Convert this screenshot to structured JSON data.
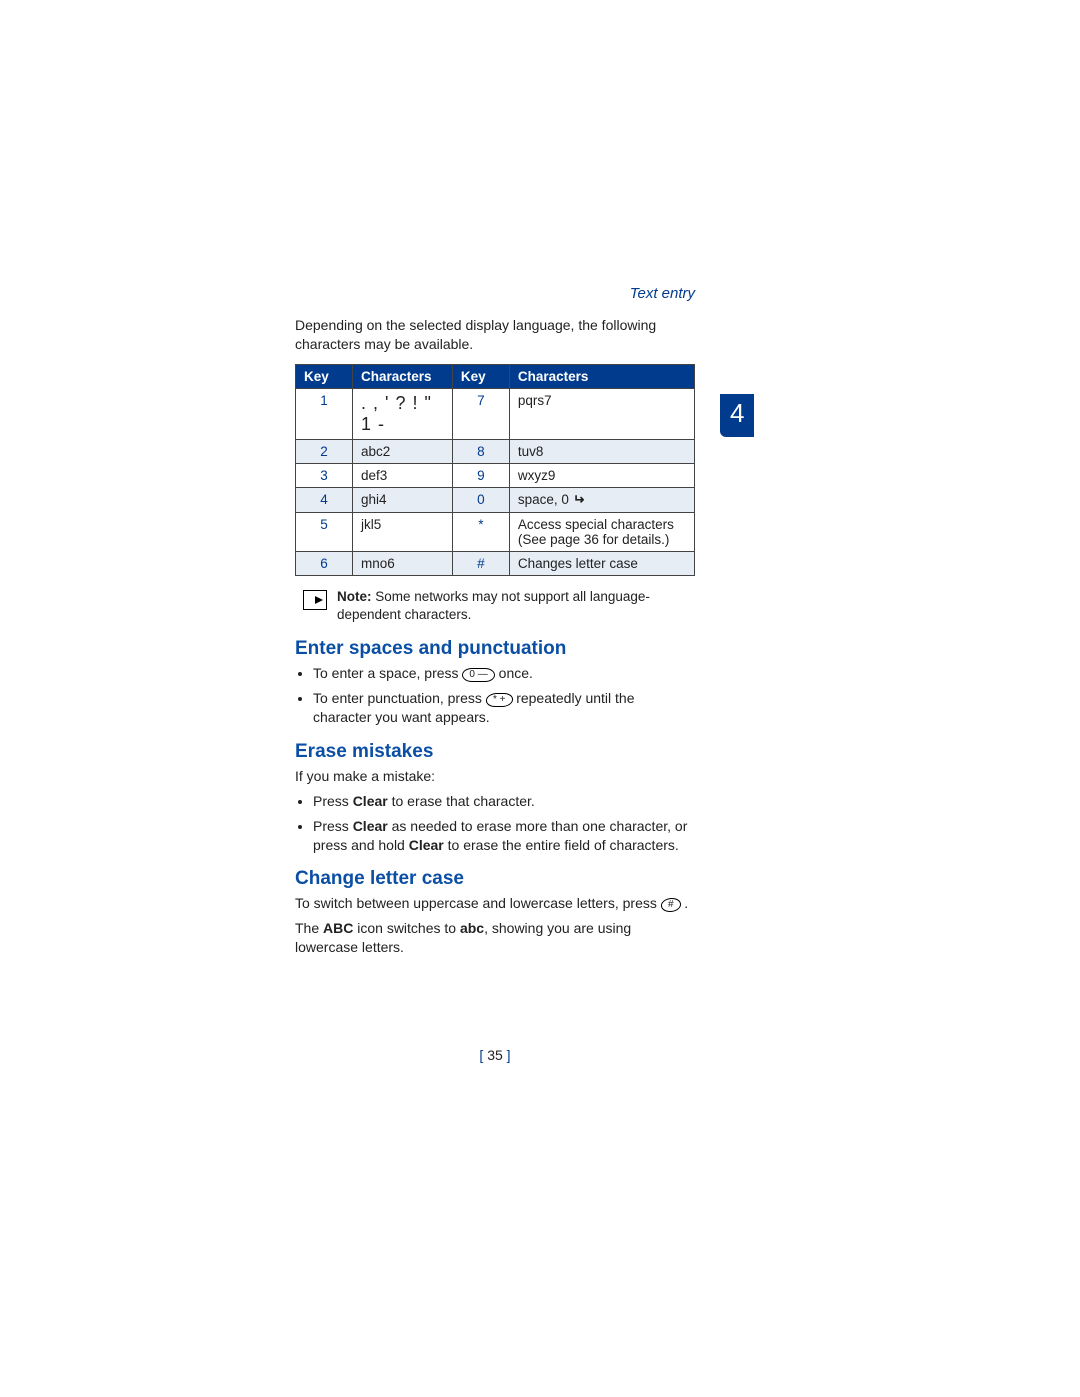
{
  "running_head": "Text entry",
  "intro": "Depending on the selected display language, the following characters may be available.",
  "side_tab": "4",
  "table": {
    "head": {
      "key": "Key",
      "chars": "Characters"
    },
    "left": [
      {
        "k": "1",
        "c": ". , ' ? ! \" 1 -",
        "big": true
      },
      {
        "k": "2",
        "c": "abc2"
      },
      {
        "k": "3",
        "c": "def3"
      },
      {
        "k": "4",
        "c": "ghi4"
      },
      {
        "k": "5",
        "c": "jkl5"
      },
      {
        "k": "6",
        "c": "mno6"
      }
    ],
    "right": [
      {
        "k": "7",
        "c": "pqrs7"
      },
      {
        "k": "8",
        "c": "tuv8"
      },
      {
        "k": "9",
        "c": "wxyz9"
      },
      {
        "k": "0",
        "c": "space, 0",
        "enter": true
      },
      {
        "k": "*",
        "c": "Access special characters (See page 36 for details.)"
      },
      {
        "k": "#",
        "c": "Changes letter case"
      }
    ]
  },
  "note": {
    "label": "Note:",
    "text": "Some networks may not support all language-dependent characters."
  },
  "sec1": {
    "title": "Enter spaces and punctuation",
    "b1_a": "To enter a space, press",
    "b1_key": "0 —",
    "b1_b": "once.",
    "b2_a": "To enter punctuation, press",
    "b2_key": "* +",
    "b2_b": "repeatedly until the character you want appears."
  },
  "sec2": {
    "title": "Erase mistakes",
    "lead": "If you make a mistake:",
    "b1_a": "Press",
    "b1_bold": "Clear",
    "b1_b": "to erase that character.",
    "b2_a": "Press",
    "b2_bold1": "Clear",
    "b2_b": "as needed to erase more than one character, or press and hold",
    "b2_bold2": "Clear",
    "b2_c": "to erase the entire field of characters."
  },
  "sec3": {
    "title": "Change letter case",
    "p1_a": "To switch between uppercase and lowercase letters, press",
    "p1_key": "#",
    "p1_b": ".",
    "p2_a": "The",
    "p2_bold1": "ABC",
    "p2_b": "icon switches to",
    "p2_bold2": "abc",
    "p2_c": ", showing you are using lowercase letters."
  },
  "page_number": "35"
}
